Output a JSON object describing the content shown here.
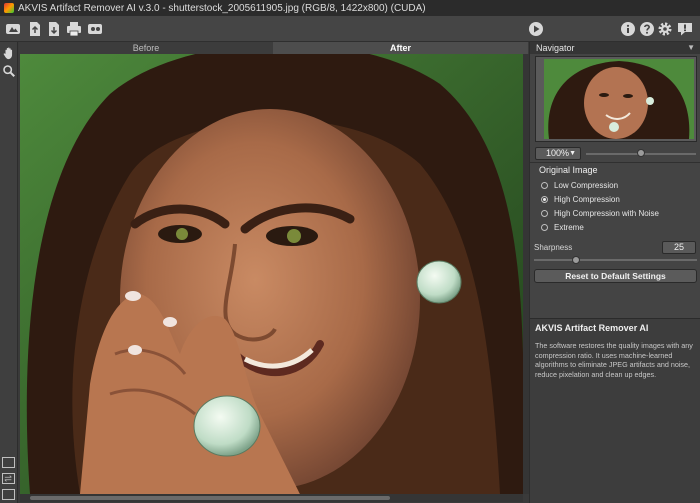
{
  "window": {
    "title": "AKVIS Artifact Remover AI v.3.0 - shutterstock_2005611905.jpg (RGB/8, 1422x800) (CUDA)"
  },
  "toolbar": {
    "left_icons": [
      "home-icon",
      "open-file-icon",
      "save-file-icon",
      "print-icon",
      "share-icon"
    ],
    "right_icons": [
      "run-icon",
      "info-icon",
      "help-icon",
      "settings-icon",
      "notification-icon"
    ]
  },
  "tools": [
    "hand-icon",
    "zoom-icon"
  ],
  "view_tabs": {
    "before": "Before",
    "after": "After"
  },
  "navigator": {
    "title": "Navigator",
    "zoom": "100%"
  },
  "settings": {
    "section_title": "Original Image",
    "options": [
      {
        "label": "Low Compression",
        "selected": false
      },
      {
        "label": "High Compression",
        "selected": true
      },
      {
        "label": "High Compression with Noise",
        "selected": false
      },
      {
        "label": "Extreme",
        "selected": false
      }
    ],
    "sharpness_label": "Sharpness",
    "sharpness_value": "25",
    "reset_label": "Reset to Default Settings"
  },
  "info": {
    "title": "AKVIS Artifact Remover AI",
    "text": "The software restores the quality images with any compression ratio. It uses machine-learned algorithms to eliminate JPEG artifacts and noise, reduce pixelation and clean up edges."
  },
  "colors": {
    "panel_bg": "#444444",
    "toolbar_bg": "#454545",
    "canvas_bg": "#2f5a28"
  }
}
